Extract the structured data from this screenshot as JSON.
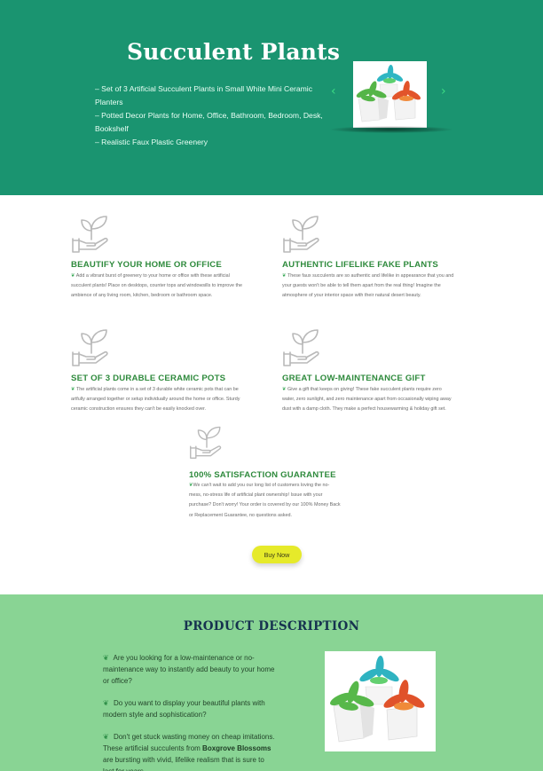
{
  "hero": {
    "title": "Succulent Plants",
    "bullets": [
      "– Set of 3 Artificial Succulent Plants in Small White Mini Ceramic Planters",
      "– Potted Decor Plants for Home, Office, Bathroom, Bedroom, Desk, Bookshelf",
      "– Realistic Faux Plastic Greenery"
    ],
    "carousel": {
      "prev_icon": "chevron-left-icon",
      "next_icon": "chevron-right-icon",
      "prev_glyph": "‹",
      "next_glyph": "›"
    }
  },
  "features": [
    {
      "icon": "hand-sprout-icon",
      "title": "BEAUTIFY YOUR HOME OR OFFICE",
      "lines": [
        "Add a vibrant burst of greenery to your home or office with these artificial",
        "succulent plants! Place on desktops, counter tops and windowsills to improve the",
        "ambience of any living room, kitchen, bedroom or bathroom space."
      ]
    },
    {
      "icon": "hand-sprout-icon",
      "title": "AUTHENTIC LIFELIKE FAKE PLANTS",
      "lines": [
        "These faux succulents are so authentic and lifelike in appearance that you and",
        "your guests won't be able to tell them apart from the real thing! Imagine the",
        "atmosphere of your interior space with their natural desert beauty."
      ]
    },
    {
      "icon": "hand-sprout-icon",
      "title": "SET OF 3 DURABLE CERAMIC POTS",
      "lines": [
        "The artificial plants come in a set of 3 durable white ceramic pots that can be",
        "artfully arranged together or setup individually around the home or office. Sturdy",
        "ceramic construction ensures they can't be easily knocked over."
      ]
    },
    {
      "icon": "hand-sprout-icon",
      "title": "GREAT LOW-MAINTENANCE GIFT",
      "lines": [
        "Give a gift that keeps on giving! These fake succulent plants require zero",
        "water, zero sunlight, and zero maintenance apart from occasionally wiping away",
        "dust with a damp cloth. They make a perfect housewarming & holiday gift set."
      ]
    },
    {
      "icon": "hand-sprout-icon",
      "title": "100% SATISFACTION GUARANTEE",
      "lines": [
        "We can't wait to add you our long list of customers loving the no-",
        "mess, no-stress life of artificial plant ownership! Issue with your",
        "purchase? Don't worry! Your order is covered by our 100% Money Back",
        "or Replacement Guarantee, no questions asked."
      ]
    }
  ],
  "feature_bullet_glyph": "❦",
  "buy_button": {
    "label": "Buy Now",
    "color": "#e6ea2a"
  },
  "description": {
    "title": "PRODUCT DESCRIPTION",
    "paragraphs": [
      {
        "text": "Are you looking for a low-maintenance or no-maintenance way to instantly add beauty to your home or office?"
      },
      {
        "text": "Do you want to display your beautiful plants with modern style and sophistication?"
      },
      {
        "text_before": "Don't get stuck wasting money on cheap imitations. These artificial succulents from ",
        "bold": "Boxgrove Blossoms",
        "text_after": " are bursting with vivid, lifelike realism that is sure to last for years."
      }
    ]
  },
  "colors": {
    "hero_bg": "#1a9470",
    "desc_bg": "#89d494",
    "feature_title": "#2e8a3c",
    "accent_green": "#3ddc84"
  }
}
